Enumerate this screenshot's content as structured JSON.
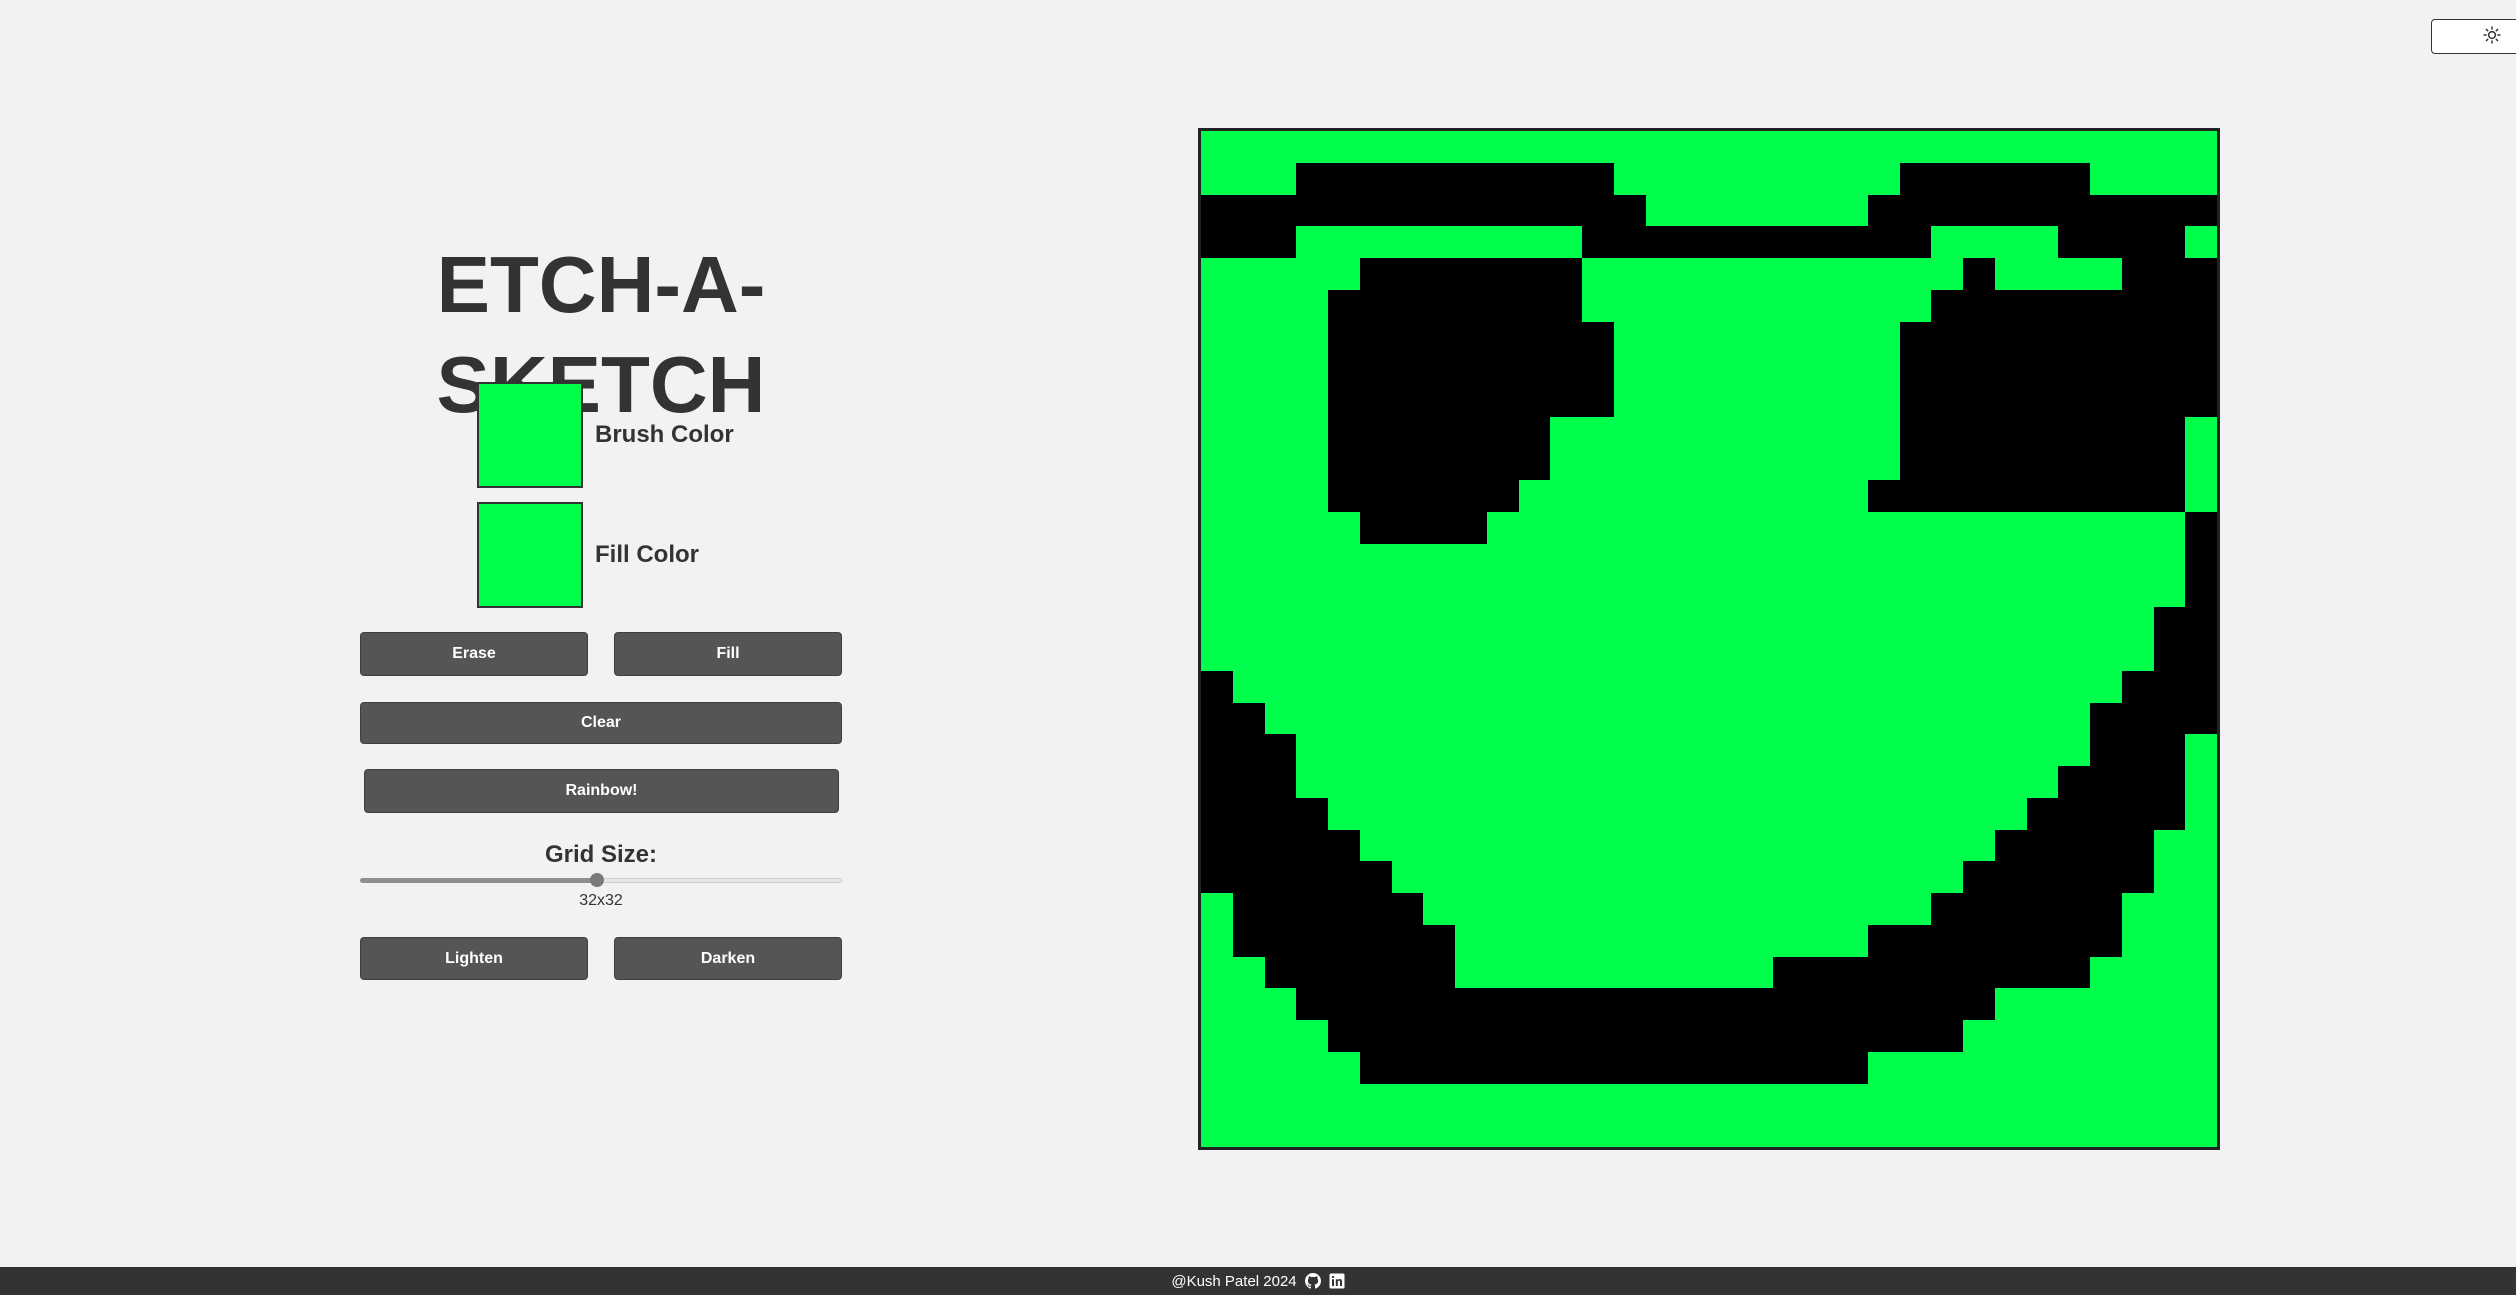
{
  "header": {
    "title": "ETCH-A-SKETCH",
    "theme_toggle_icon": "sun-icon"
  },
  "controls": {
    "brush": {
      "label": "Brush Color",
      "color": "#00ff4c"
    },
    "fill": {
      "label": "Fill Color",
      "color": "#00ff4c"
    },
    "buttons": {
      "erase": "Erase",
      "fill": "Fill",
      "clear": "Clear",
      "rainbow": "Rainbow!",
      "lighten": "Lighten",
      "darken": "Darken"
    },
    "grid_size": {
      "label": "Grid Size:",
      "value": 32,
      "min": 1,
      "max": 64,
      "display": "32x32"
    }
  },
  "canvas": {
    "size": 32,
    "background": "#00ff4c",
    "ink": "#000000",
    "pixels": [
      "................................",
      "...##########.........######....",
      "##############.......###########",
      "###.........###########....####.",
      ".....#######............#....###",
      "....########...........#########",
      "....#########.........##########",
      "....#########.........##########",
      "....#########.........##########",
      "....#######...........#########.",
      "....#######...........#########.",
      "....######...........##########.",
      ".....####......................#",
      "...............................#",
      "...............................#",
      "..............................##",
      "..............................##",
      "#............................###",
      "##..........................####",
      "###.........................###.",
      "###........................####.",
      "####......................#####.",
      "#####....................#####..",
      "######..................######..",
      ".######................######...",
      ".#######.............########...",
      "..######..........##########....",
      "...######################.......",
      "....####################........",
      ".....################...........",
      "................................",
      "................................"
    ]
  },
  "footer": {
    "credit": "@Kush Patel 2024",
    "icons": [
      "github-icon",
      "linkedin-icon"
    ]
  }
}
